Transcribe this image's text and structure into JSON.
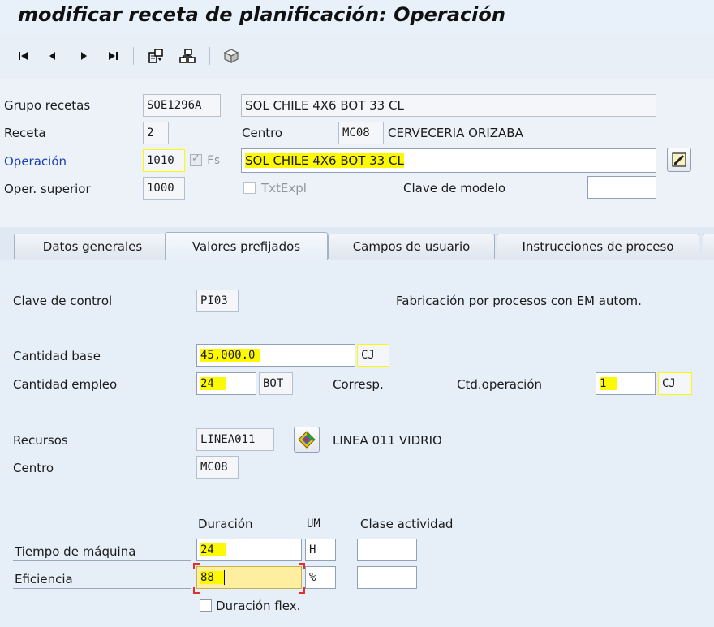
{
  "window": {
    "title": "modificar receta de planificación: Operación"
  },
  "toolbar": {
    "icons": [
      "first-page-icon",
      "previous-page-icon",
      "next-page-icon",
      "last-page-icon",
      "header-overview-icon",
      "hierarchy-icon",
      "cube-icon"
    ],
    "glyphs": {
      "first": "⏮",
      "prev": "◀",
      "next": "▶",
      "last": "⏭"
    }
  },
  "header": {
    "grupo_recetas_label": "Grupo recetas",
    "grupo_recetas_value": "SOE1296A",
    "grupo_recetas_desc": "SOL CHILE 4X6 BOT 33 CL",
    "receta_label": "Receta",
    "receta_value": "2",
    "centro_label": "Centro",
    "centro_value": "MC08",
    "centro_desc": "CERVECERIA ORIZABA",
    "operacion_label": "Operación",
    "operacion_value": "1010",
    "fs_label": "Fs",
    "operacion_desc": "SOL CHILE 4X6 BOT 33 CL",
    "oper_superior_label": "Oper. superior",
    "oper_superior_value": "1000",
    "txtexpl_label": "TxtExpl",
    "clave_modelo_label": "Clave de modelo",
    "clave_modelo_value": ""
  },
  "tabs": [
    {
      "label": "Datos generales"
    },
    {
      "label": "Valores prefijados"
    },
    {
      "label": "Campos de usuario"
    },
    {
      "label": "Instrucciones de proceso"
    }
  ],
  "form": {
    "clave_control_label": "Clave de control",
    "clave_control_value": "PI03",
    "clave_control_desc": "Fabricación por procesos con EM autom.",
    "cantidad_base_label": "Cantidad base",
    "cantidad_base_value": "45,000.0",
    "cantidad_base_unit": "CJ",
    "cantidad_empleo_label": "Cantidad empleo",
    "cantidad_empleo_value": "24",
    "cantidad_empleo_unit": "BOT",
    "corresp_label": "Corresp.",
    "ctd_operacion_label": "Ctd.operación",
    "ctd_operacion_value": "1",
    "ctd_operacion_unit": "CJ",
    "recursos_label": "Recursos",
    "recursos_value": "LINEA011",
    "recursos_desc": "LINEA 011 VIDRIO",
    "centro_label": "Centro",
    "centro_value": "MC08",
    "duracion_header": "Duración",
    "um_header": "UM",
    "clase_actividad_header": "Clase actividad",
    "tiempo_maquina_label": "Tiempo de máquina",
    "tiempo_maquina_value": "24",
    "tiempo_maquina_um": "H",
    "tiempo_maquina_clase": "",
    "eficiencia_label": "Eficiencia",
    "eficiencia_value": "88",
    "eficiencia_um": "%",
    "eficiencia_clase": "",
    "duracion_flex_label": "Duración flex."
  },
  "colors": {
    "highlight": "#fdf900",
    "link_blue": "#1a3fb5",
    "cursor_marks": "#e03030"
  }
}
